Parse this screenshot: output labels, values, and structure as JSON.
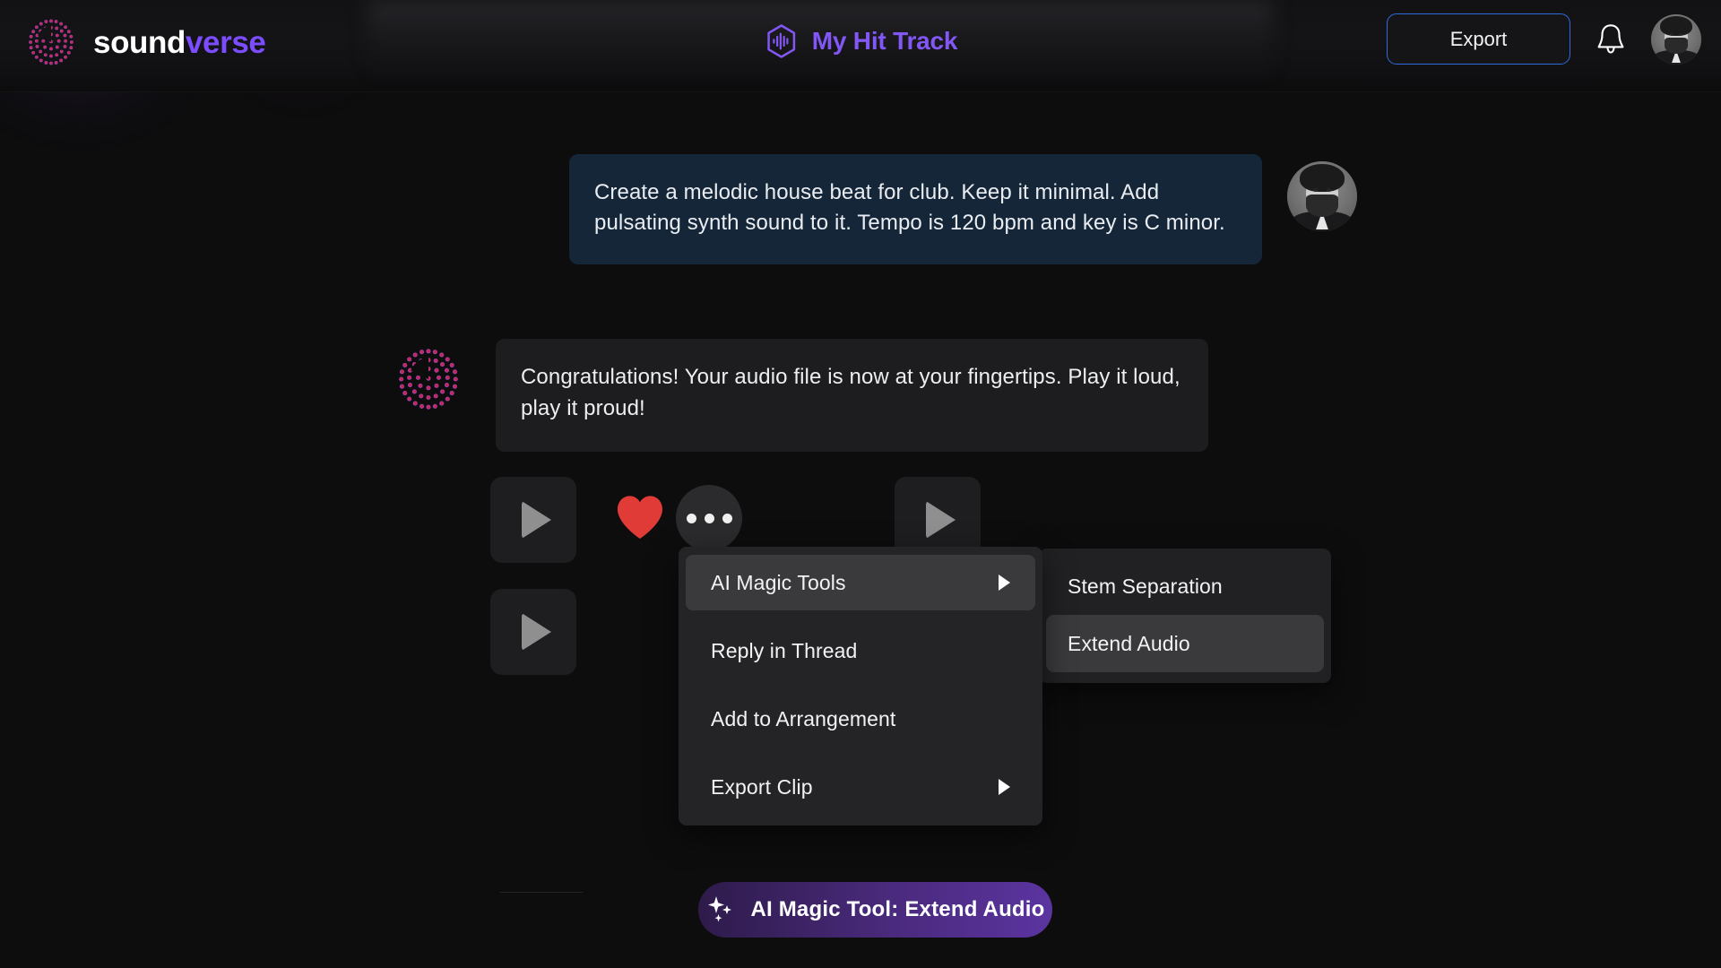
{
  "brand": {
    "name_part1": "sound",
    "name_part2": "verse",
    "logo_icon": "soundverse-dot-logo"
  },
  "header": {
    "track_icon": "waveform-hexagon-icon",
    "track_title": "My Hit Track",
    "export_label": "Export",
    "bell_icon": "notification-bell-icon",
    "avatar_icon": "user-avatar"
  },
  "conversation": {
    "user_message": "Create a melodic house beat for club. Keep it minimal. Add pulsating synth sound to it. Tempo is 120 bpm and key is C minor.",
    "user_avatar_icon": "user-avatar",
    "assistant_avatar_icon": "soundverse-dot-logo",
    "assistant_message": "Congratulations! Your audio file is now at your fingertips. Play it loud, play it proud!"
  },
  "actions": {
    "play_icon": "play-icon",
    "heart_icon": "heart-filled-icon",
    "more_icon": "more-horizontal-icon"
  },
  "context_menu": {
    "items": [
      {
        "label": "AI Magic Tools",
        "has_submenu": true,
        "active": true
      },
      {
        "label": "Reply in Thread",
        "has_submenu": false,
        "active": false
      },
      {
        "label": "Add to Arrangement",
        "has_submenu": false,
        "active": false
      },
      {
        "label": "Export Clip",
        "has_submenu": true,
        "active": false
      }
    ]
  },
  "submenu": {
    "items": [
      {
        "label": "Stem Separation",
        "active": false
      },
      {
        "label": "Extend Audio",
        "active": true
      }
    ]
  },
  "bottom_bar": {
    "magic_tool_label": "AI Magic Tool: Extend Audio",
    "sparkle_icon": "sparkles-icon"
  },
  "colors": {
    "brand_purple": "#7c4dff",
    "title_purple": "#8257f5",
    "export_border_blue": "#2f6bdf",
    "user_bubble": "#152638",
    "bot_bubble": "#1d1d1f",
    "heart_red": "#e03b36",
    "page_background": "#0d0d0e",
    "menu_background": "#242426",
    "menu_active": "#3a3a3c"
  }
}
